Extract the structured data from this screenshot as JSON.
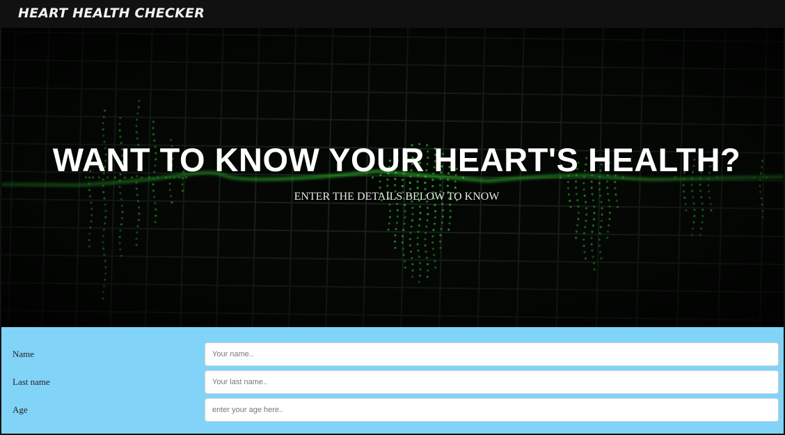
{
  "navbar": {
    "brand": "HEART HEALTH CHECKER"
  },
  "hero": {
    "title": "WANT TO KNOW YOUR HEART'S HEALTH?",
    "subtitle": "ENTER THE DETAILS BELOW TO KNOW",
    "background": "ecg-monitor-image"
  },
  "form": {
    "fields": [
      {
        "label": "Name",
        "placeholder": "Your name..",
        "value": ""
      },
      {
        "label": "Last name",
        "placeholder": "Your last name..",
        "value": ""
      },
      {
        "label": "Age",
        "placeholder": "enter your age here..",
        "value": ""
      }
    ]
  },
  "colors": {
    "navbar": "#111111",
    "form_background": "#81d4f8",
    "ecg_green": "#2fbf2f"
  }
}
